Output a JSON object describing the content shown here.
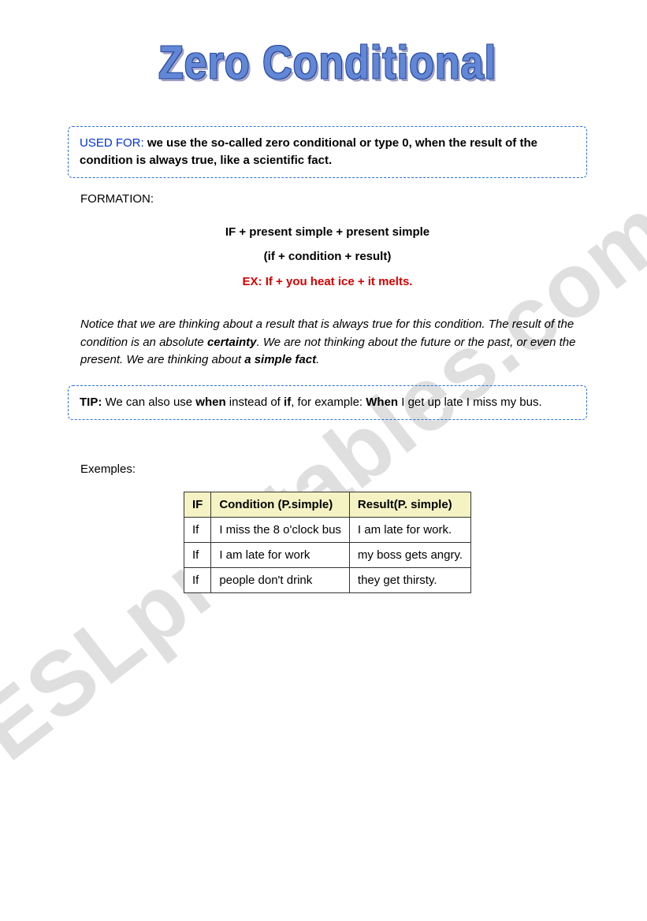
{
  "title": "Zero Conditional",
  "watermark": "ESLprintables.com",
  "used_for": {
    "label": "USED FOR:",
    "text": " we use the so-called zero conditional or type 0, when the result of the condition is always true, like a scientific fact."
  },
  "formation_label": "FORMATION:",
  "formula": "IF + present simple + present simple",
  "paren": "(if    + condition   +   result)",
  "example_line": "EX: If + you heat ice + it melts.",
  "notice": {
    "pre": "Notice that we are thinking about a result that is always true for this condition. The result of the condition is an absolute ",
    "certainty": "certainty",
    "mid": ". We are not thinking about the future or the past, or even the present. We are thinking about ",
    "fact": "a simple fact",
    "post": "."
  },
  "tip": {
    "label": "TIP:",
    "t1": " We can also use ",
    "when1": "when",
    "t2": " instead of ",
    "if1": "if",
    "t3": ", for example: ",
    "when2": "When",
    "t4": " I get up late I miss my bus."
  },
  "examples_label": "Exemples:",
  "table": {
    "headers": {
      "c0": "IF",
      "c1": "Condition (P.simple)",
      "c2": "Result(P. simple)"
    },
    "rows": [
      {
        "c0": "If",
        "c1": "I miss the 8 o'clock bus",
        "c2": "I am late for work."
      },
      {
        "c0": "If",
        "c1": "I am late for work",
        "c2": "my boss gets angry."
      },
      {
        "c0": "If",
        "c1": "people don't drink",
        "c2": "they get thirsty."
      }
    ]
  }
}
